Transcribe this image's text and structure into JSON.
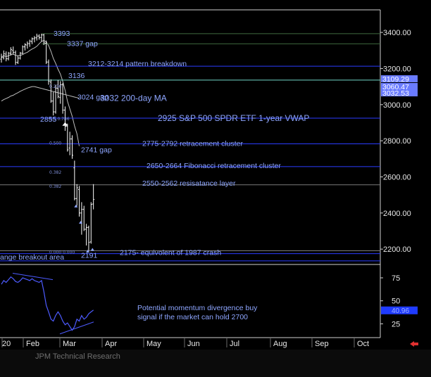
{
  "colors": {
    "background": "#000000",
    "frame": "#d0d0d0",
    "annotation": "#8ea6ff",
    "level_line": "#2b3cff",
    "ma_line": "#bdbdbd",
    "bar": "#ffffff",
    "momentum": "#4d5bff",
    "tick_text": "#e8e8e8",
    "price_tag_bg": "#6a7bff",
    "momentum_tag_bg": "#1f3bff",
    "nav_arrow": "#e03030"
  },
  "footer": {
    "source": "JPM Technical Research"
  },
  "chart_data": {
    "type": "ohlc-bar",
    "price_axis": {
      "ticks": [
        3400,
        3200,
        3000,
        2800,
        2600,
        2400,
        2200
      ],
      "tick_labels": [
        "3400.00",
        "3200.00",
        "3000.00",
        "2800.00",
        "2600.00",
        "2400.00",
        "2200.00"
      ],
      "range": [
        2115,
        3525
      ]
    },
    "momentum_axis": {
      "ticks": [
        75,
        50,
        25
      ],
      "range": [
        10,
        88
      ]
    },
    "x_axis": {
      "tick_labels": [
        "20",
        "Feb",
        "Mar",
        "Apr",
        "May",
        "Jun",
        "Jul",
        "Aug",
        "Sep",
        "Oct"
      ]
    },
    "price_tags": [
      {
        "label": "3109.29",
        "value": 3109
      },
      {
        "label": "3060.47",
        "value": 3060
      },
      {
        "label": "3032.53",
        "value": 3032
      }
    ],
    "momentum_tag": {
      "label": "40.96",
      "value": 40
    },
    "levels": [
      {
        "value": 3393,
        "label": "3393",
        "style": "gap"
      },
      {
        "value": 3337,
        "label": "3337 gap",
        "style": "gap"
      },
      {
        "value": 3213,
        "label": "3212-3214 pattern breakdown",
        "style": "blue"
      },
      {
        "value": 3136,
        "label": "3136",
        "style": "cyan"
      },
      {
        "value": 3032,
        "label": "3032 200-day MA",
        "style": "none"
      },
      {
        "value": 3024,
        "label": "3024 gap",
        "style": "none"
      },
      {
        "value": 2925,
        "label": "2925 S&P 500 SPDR ETF 1-year VWAP",
        "style": "blue"
      },
      {
        "value": 2855,
        "label": "2855",
        "style": "none"
      },
      {
        "value": 2783,
        "label": "2775-2792 retracement cluster",
        "style": "blue"
      },
      {
        "value": 2741,
        "label": "2741 gap",
        "style": "none"
      },
      {
        "value": 2657,
        "label": "2650-2664 Fibonacci retracement cluster",
        "style": "blue"
      },
      {
        "value": 2556,
        "label": "2550-2562 resisatance layer",
        "style": "gray"
      },
      {
        "value": 2191,
        "label": "2191",
        "style": "gray"
      },
      {
        "value": 2175,
        "label": "2175- equivolent of 1987 crash",
        "style": "blue"
      }
    ],
    "range_label": "ange breakout area",
    "momentum_note": [
      "Potential momentum divergence buy",
      "signal if the market can hold 2700"
    ],
    "fib_labels": [
      {
        "text": "0.236",
        "value": 3105
      },
      {
        "text": "0.5  0.786",
        "value": 2925
      },
      {
        "text": "0.500",
        "value": 2790
      },
      {
        "text": "0.382",
        "value": 2630
      },
      {
        "text": "0.382",
        "value": 2552
      },
      {
        "text": "0.000  0.000",
        "value": 2187
      }
    ],
    "ohlc": [
      {
        "o": 3252,
        "h": 3282,
        "l": 3233,
        "c": 3262
      },
      {
        "o": 3260,
        "h": 3300,
        "l": 3250,
        "c": 3282
      },
      {
        "o": 3280,
        "h": 3295,
        "l": 3240,
        "c": 3254
      },
      {
        "o": 3254,
        "h": 3292,
        "l": 3245,
        "c": 3285
      },
      {
        "o": 3285,
        "h": 3318,
        "l": 3272,
        "c": 3305
      },
      {
        "o": 3300,
        "h": 3322,
        "l": 3278,
        "c": 3290
      },
      {
        "o": 3288,
        "h": 3300,
        "l": 3220,
        "c": 3234
      },
      {
        "o": 3234,
        "h": 3272,
        "l": 3225,
        "c": 3258
      },
      {
        "o": 3258,
        "h": 3292,
        "l": 3250,
        "c": 3285
      },
      {
        "o": 3285,
        "h": 3328,
        "l": 3280,
        "c": 3320
      },
      {
        "o": 3320,
        "h": 3340,
        "l": 3300,
        "c": 3332
      },
      {
        "o": 3330,
        "h": 3350,
        "l": 3310,
        "c": 3338
      },
      {
        "o": 3338,
        "h": 3360,
        "l": 3320,
        "c": 3352
      },
      {
        "o": 3350,
        "h": 3372,
        "l": 3335,
        "c": 3365
      },
      {
        "o": 3365,
        "h": 3380,
        "l": 3345,
        "c": 3370
      },
      {
        "o": 3370,
        "h": 3393,
        "l": 3355,
        "c": 3380
      },
      {
        "o": 3380,
        "h": 3390,
        "l": 3360,
        "c": 3372
      },
      {
        "o": 3372,
        "h": 3393,
        "l": 3350,
        "c": 3386
      },
      {
        "o": 3386,
        "h": 3392,
        "l": 3330,
        "c": 3342
      },
      {
        "o": 3340,
        "h": 3355,
        "l": 3225,
        "c": 3236
      },
      {
        "o": 3236,
        "h": 3250,
        "l": 3110,
        "c": 3130
      },
      {
        "o": 3125,
        "h": 3140,
        "l": 3010,
        "c": 3020
      },
      {
        "o": 3020,
        "h": 3070,
        "l": 2940,
        "c": 2960
      },
      {
        "o": 2960,
        "h": 3110,
        "l": 2950,
        "c": 3090
      },
      {
        "o": 3090,
        "h": 3136,
        "l": 3035,
        "c": 3045
      },
      {
        "o": 3040,
        "h": 3130,
        "l": 3005,
        "c": 3110
      },
      {
        "o": 3110,
        "h": 3120,
        "l": 2950,
        "c": 2970
      },
      {
        "o": 2970,
        "h": 2990,
        "l": 2855,
        "c": 2880
      },
      {
        "o": 2880,
        "h": 2895,
        "l": 2740,
        "c": 2750
      },
      {
        "o": 2760,
        "h": 2850,
        "l": 2720,
        "c": 2810
      },
      {
        "o": 2810,
        "h": 2830,
        "l": 2700,
        "c": 2720
      },
      {
        "o": 2650,
        "h": 2690,
        "l": 2470,
        "c": 2480
      },
      {
        "o": 2480,
        "h": 2560,
        "l": 2440,
        "c": 2540
      },
      {
        "o": 2530,
        "h": 2550,
        "l": 2380,
        "c": 2400
      },
      {
        "o": 2400,
        "h": 2460,
        "l": 2280,
        "c": 2420
      },
      {
        "o": 2420,
        "h": 2440,
        "l": 2300,
        "c": 2310
      },
      {
        "o": 2310,
        "h": 2340,
        "l": 2220,
        "c": 2320
      },
      {
        "o": 2320,
        "h": 2330,
        "l": 2191,
        "c": 2237
      },
      {
        "o": 2240,
        "h": 2460,
        "l": 2230,
        "c": 2448
      },
      {
        "o": 2450,
        "h": 2560,
        "l": 2420,
        "c": 2475
      }
    ],
    "momentum_series": [
      68,
      72,
      70,
      73,
      76,
      74,
      71,
      70,
      72,
      75,
      74,
      73,
      72,
      74,
      72,
      71,
      70,
      72,
      60,
      45,
      38,
      30,
      28,
      34,
      38,
      34,
      28,
      24,
      26,
      22,
      18,
      22,
      30,
      28,
      34,
      30,
      32,
      36,
      38,
      40
    ]
  }
}
